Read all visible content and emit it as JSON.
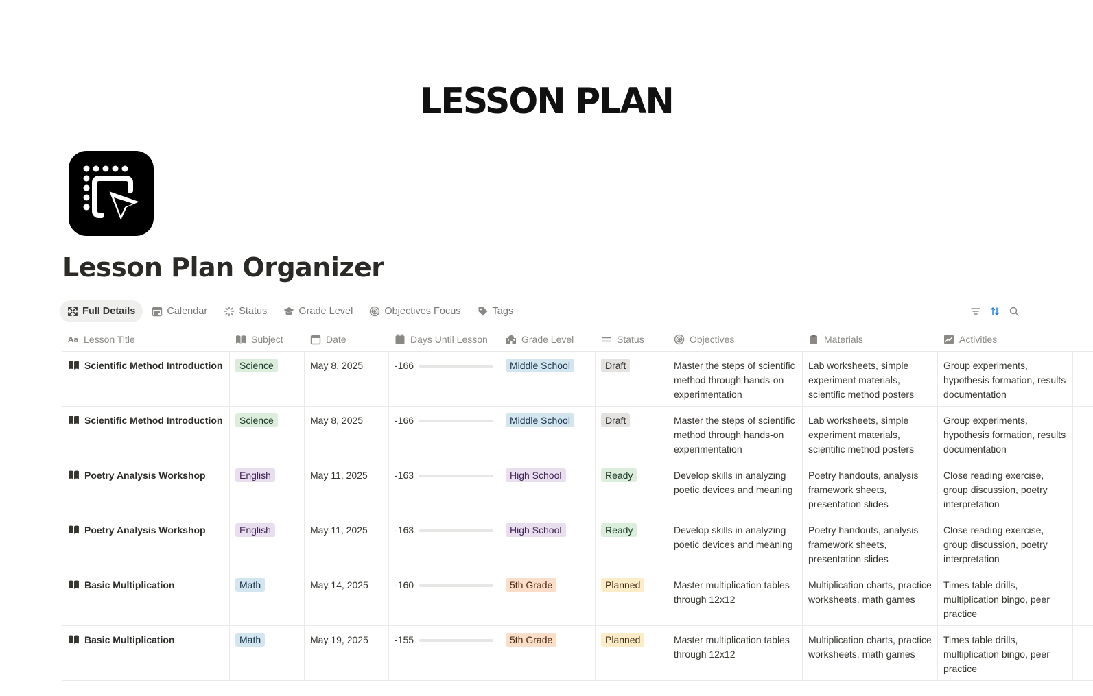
{
  "cover": {
    "title": "LESSON PLAN"
  },
  "page": {
    "title": "Lesson Plan Organizer",
    "icon": "cursor-tap-icon"
  },
  "tabs": [
    {
      "label": "Full Details",
      "icon": "expand-icon",
      "active": true
    },
    {
      "label": "Calendar",
      "icon": "calendar-icon"
    },
    {
      "label": "Status",
      "icon": "loader-icon"
    },
    {
      "label": "Grade Level",
      "icon": "graduation-cap-icon"
    },
    {
      "label": "Objectives Focus",
      "icon": "target-icon"
    },
    {
      "label": "Tags",
      "icon": "tag-icon"
    }
  ],
  "toolbar": {
    "filter": "filter-icon",
    "sort": "sort-icon",
    "search": "search-icon"
  },
  "columns": [
    {
      "label": "Lesson Title",
      "icon": "text-property-icon"
    },
    {
      "label": "Subject",
      "icon": "book-icon"
    },
    {
      "label": "Date",
      "icon": "calendar-icon"
    },
    {
      "label": "Days Until Lesson",
      "icon": "calendar-day-icon"
    },
    {
      "label": "Grade Level",
      "icon": "school-icon"
    },
    {
      "label": "Status",
      "icon": "lines-icon"
    },
    {
      "label": "Objectives",
      "icon": "target-icon"
    },
    {
      "label": "Materials",
      "icon": "clipboard-icon"
    },
    {
      "label": "Activities",
      "icon": "chart-icon"
    }
  ],
  "colors": {
    "science": {
      "bg": "#dbeddb",
      "fg": "#1c3829"
    },
    "english": {
      "bg": "#e8deee",
      "fg": "#412454"
    },
    "math": {
      "bg": "#d3e5ef",
      "fg": "#183347"
    },
    "middle_school": {
      "bg": "#d3e5ef",
      "fg": "#183347"
    },
    "high_school": {
      "bg": "#e8deee",
      "fg": "#412454"
    },
    "fifth_grade": {
      "bg": "#fadec9",
      "fg": "#49290e"
    },
    "draft": {
      "bg": "#e3e2e0",
      "fg": "#32302c"
    },
    "ready": {
      "bg": "#dbeddb",
      "fg": "#1c3829"
    },
    "planned": {
      "bg": "#fdecc8",
      "fg": "#402c1b"
    },
    "progress_bar": "#e6e6e4"
  },
  "rows": [
    {
      "title": "Scientific Method Introduction",
      "subject": "Science",
      "subject_color": "science",
      "date": "May 8, 2025",
      "days": "-166",
      "grade": "Middle School",
      "grade_color": "middle_school",
      "status": "Draft",
      "status_color": "draft",
      "objectives": "Master the steps of scientific method through hands-on experimentation",
      "materials": "Lab worksheets, simple experiment materials, scientific method posters",
      "activities": "Group experiments, hypothesis formation, results documentation"
    },
    {
      "title": "Scientific Method Introduction",
      "subject": "Science",
      "subject_color": "science",
      "date": "May 8, 2025",
      "days": "-166",
      "grade": "Middle School",
      "grade_color": "middle_school",
      "status": "Draft",
      "status_color": "draft",
      "objectives": "Master the steps of scientific method through hands-on experimentation",
      "materials": "Lab worksheets, simple experiment materials, scientific method posters",
      "activities": "Group experiments, hypothesis formation, results documentation"
    },
    {
      "title": "Poetry Analysis Workshop",
      "subject": "English",
      "subject_color": "english",
      "date": "May 11, 2025",
      "days": "-163",
      "grade": "High School",
      "grade_color": "high_school",
      "status": "Ready",
      "status_color": "ready",
      "objectives": "Develop skills in analyzing poetic devices and meaning",
      "materials": "Poetry handouts, analysis framework sheets, presentation slides",
      "activities": "Close reading exercise, group discussion, poetry interpretation"
    },
    {
      "title": "Poetry Analysis Workshop",
      "subject": "English",
      "subject_color": "english",
      "date": "May 11, 2025",
      "days": "-163",
      "grade": "High School",
      "grade_color": "high_school",
      "status": "Ready",
      "status_color": "ready",
      "objectives": "Develop skills in analyzing poetic devices and meaning",
      "materials": "Poetry handouts, analysis framework sheets, presentation slides",
      "activities": "Close reading exercise, group discussion, poetry interpretation"
    },
    {
      "title": "Basic Multiplication",
      "subject": "Math",
      "subject_color": "math",
      "date": "May 14, 2025",
      "days": "-160",
      "grade": "5th Grade",
      "grade_color": "fifth_grade",
      "status": "Planned",
      "status_color": "planned",
      "objectives": "Master multiplication tables through 12x12",
      "materials": "Multiplication charts, practice worksheets, math games",
      "activities": "Times table drills, multiplication bingo, peer practice"
    },
    {
      "title": "Basic Multiplication",
      "subject": "Math",
      "subject_color": "math",
      "date": "May 19, 2025",
      "days": "-155",
      "grade": "5th Grade",
      "grade_color": "fifth_grade",
      "status": "Planned",
      "status_color": "planned",
      "objectives": "Master multiplication tables through 12x12",
      "materials": "Multiplication charts, practice worksheets, math games",
      "activities": "Times table drills, multiplication bingo, peer practice"
    }
  ]
}
